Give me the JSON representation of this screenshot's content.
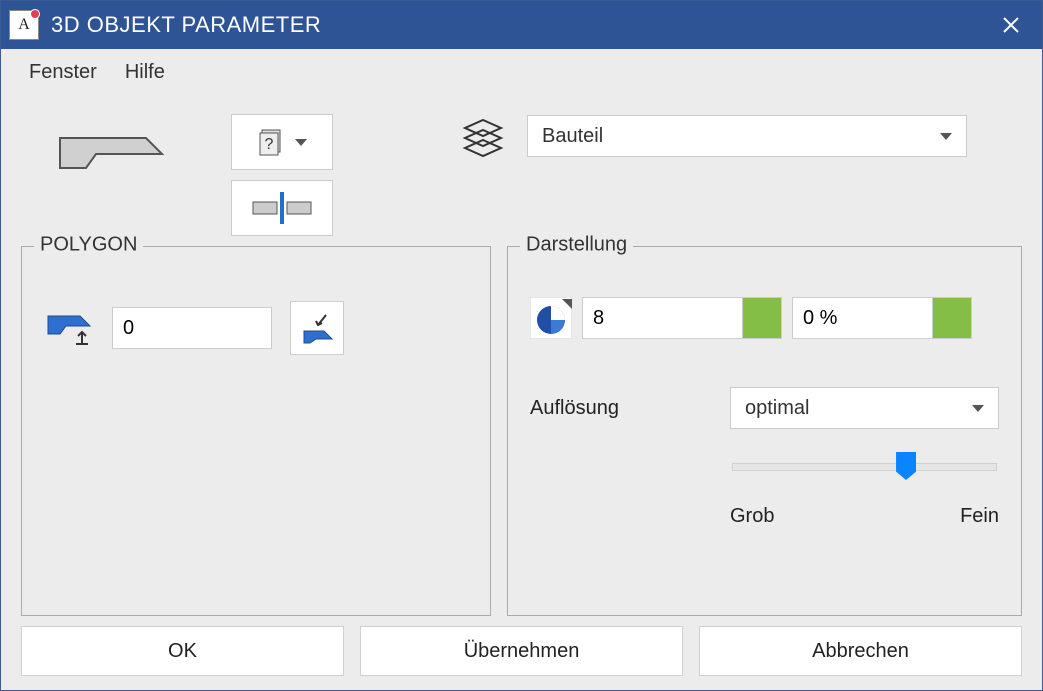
{
  "window": {
    "title": "3D OBJEKT PARAMETER"
  },
  "menubar": {
    "items": [
      "Fenster",
      "Hilfe"
    ]
  },
  "top": {
    "layer_select": "Bauteil"
  },
  "polygon": {
    "group_label": "POLYGON",
    "height_value": "0"
  },
  "darstellung": {
    "group_label": "Darstellung",
    "pen_value": "8",
    "transparency_value": "0 %",
    "auflösung_label": "Auflösung",
    "auflösung_value": "optimal",
    "slider_min_label": "Grob",
    "slider_max_label": "Fein"
  },
  "buttons": {
    "ok": "OK",
    "apply": "Übernehmen",
    "cancel": "Abbrechen"
  },
  "icons": {
    "app": "A",
    "question": "?"
  }
}
